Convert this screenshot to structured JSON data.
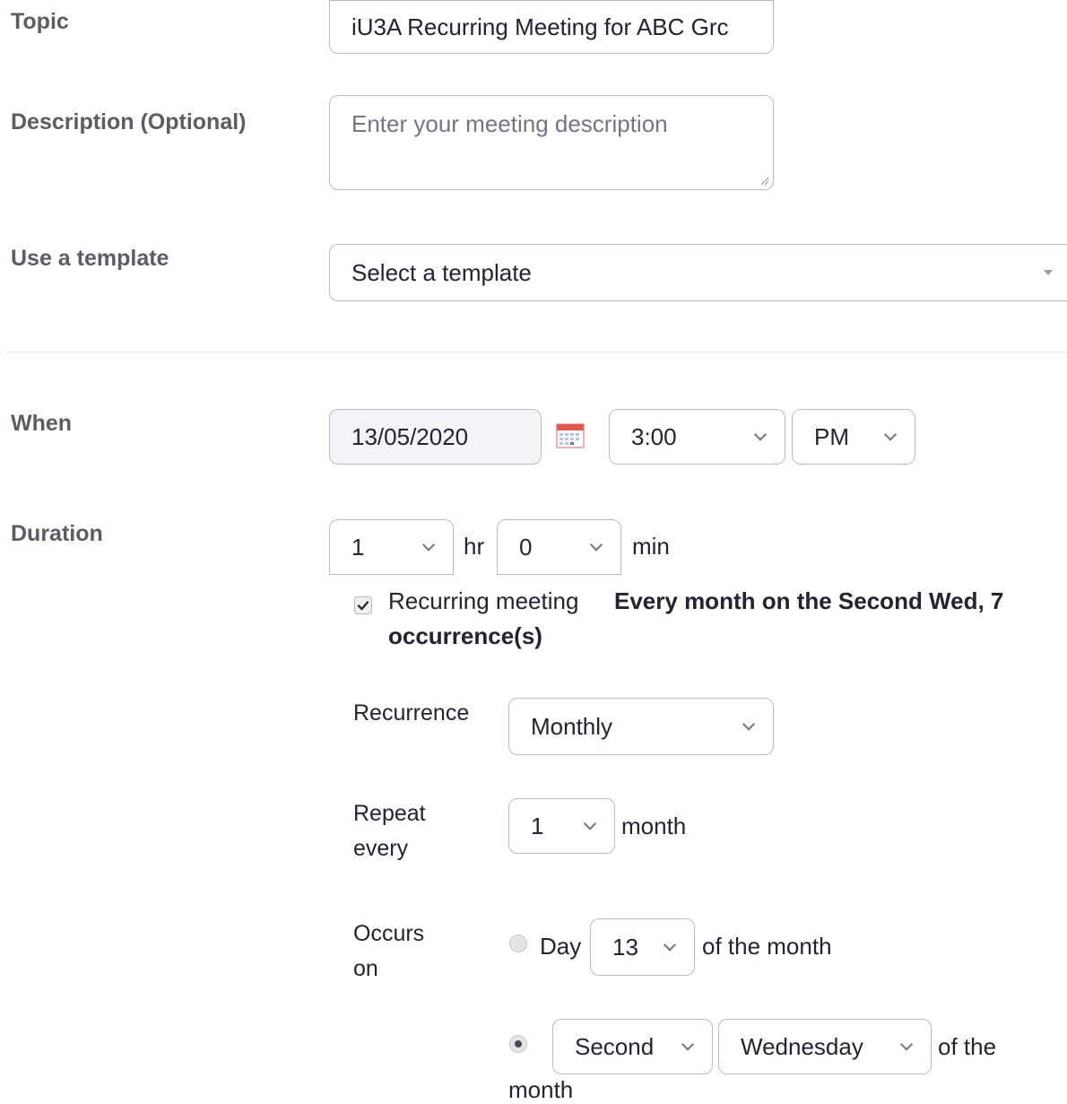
{
  "topic": {
    "label": "Topic",
    "value": "iU3A Recurring Meeting for ABC Grc"
  },
  "description": {
    "label": "Description (Optional)",
    "placeholder": "Enter your meeting description"
  },
  "template": {
    "label": "Use a template",
    "selected": "Select a template"
  },
  "when": {
    "label": "When",
    "date": "13/05/2020",
    "time": "3:00",
    "ampm": "PM"
  },
  "duration": {
    "label": "Duration",
    "hours": "1",
    "hr_unit": "hr",
    "minutes": "0",
    "min_unit": "min"
  },
  "recurring": {
    "checkbox_label": "Recurring meeting",
    "checked": true,
    "summary_line1": "Every month on the Second Wed, 7",
    "summary_line2": "occurrence(s)"
  },
  "recurrence": {
    "label": "Recurrence",
    "value": "Monthly"
  },
  "repeat_every": {
    "label_line1": "Repeat",
    "label_line2": "every",
    "value": "1",
    "unit": "month"
  },
  "occurs_on": {
    "label_line1": "Occurs",
    "label_line2": "on",
    "option_day": {
      "label": "Day",
      "value": "13",
      "suffix": "of the month",
      "selected": false
    },
    "option_week": {
      "ordinal": "Second",
      "weekday": "Wednesday",
      "suffix_line1": "of the",
      "suffix_line2": "month",
      "selected": true
    }
  },
  "colors": {
    "label_gray": "#5c5c66",
    "border": "#babac4",
    "text": "#232333"
  }
}
